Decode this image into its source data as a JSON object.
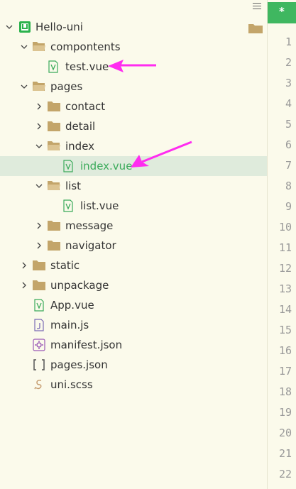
{
  "explorer": {
    "root": "Hello-uni",
    "items": [
      {
        "label": "compontents",
        "kind": "folder-open"
      },
      {
        "label": "test.vue",
        "kind": "vue"
      },
      {
        "label": "pages",
        "kind": "folder-open"
      },
      {
        "label": "contact",
        "kind": "folder"
      },
      {
        "label": "detail",
        "kind": "folder"
      },
      {
        "label": "index",
        "kind": "folder-open"
      },
      {
        "label": "index.vue",
        "kind": "vue"
      },
      {
        "label": "list",
        "kind": "folder-open"
      },
      {
        "label": "list.vue",
        "kind": "vue"
      },
      {
        "label": "message",
        "kind": "folder"
      },
      {
        "label": "navigator",
        "kind": "folder"
      },
      {
        "label": "static",
        "kind": "folder"
      },
      {
        "label": "unpackage",
        "kind": "folder"
      },
      {
        "label": "App.vue",
        "kind": "vue"
      },
      {
        "label": "main.js",
        "kind": "js"
      },
      {
        "label": "manifest.json",
        "kind": "manifest"
      },
      {
        "label": "pages.json",
        "kind": "json"
      },
      {
        "label": "uni.scss",
        "kind": "scss"
      }
    ]
  },
  "editor": {
    "tab_marker": "*",
    "line_numbers": [
      "1",
      "2",
      "3",
      "4",
      "5",
      "6",
      "7",
      "8",
      "9",
      "10",
      "11",
      "12",
      "13",
      "14",
      "15",
      "16",
      "17",
      "18",
      "19",
      "20",
      "21",
      "22"
    ]
  },
  "colors": {
    "selection": "#dfebdc",
    "accent_green": "#3fb760",
    "arrow_magenta": "#ff2cf0",
    "folder": "#c3a56a"
  }
}
